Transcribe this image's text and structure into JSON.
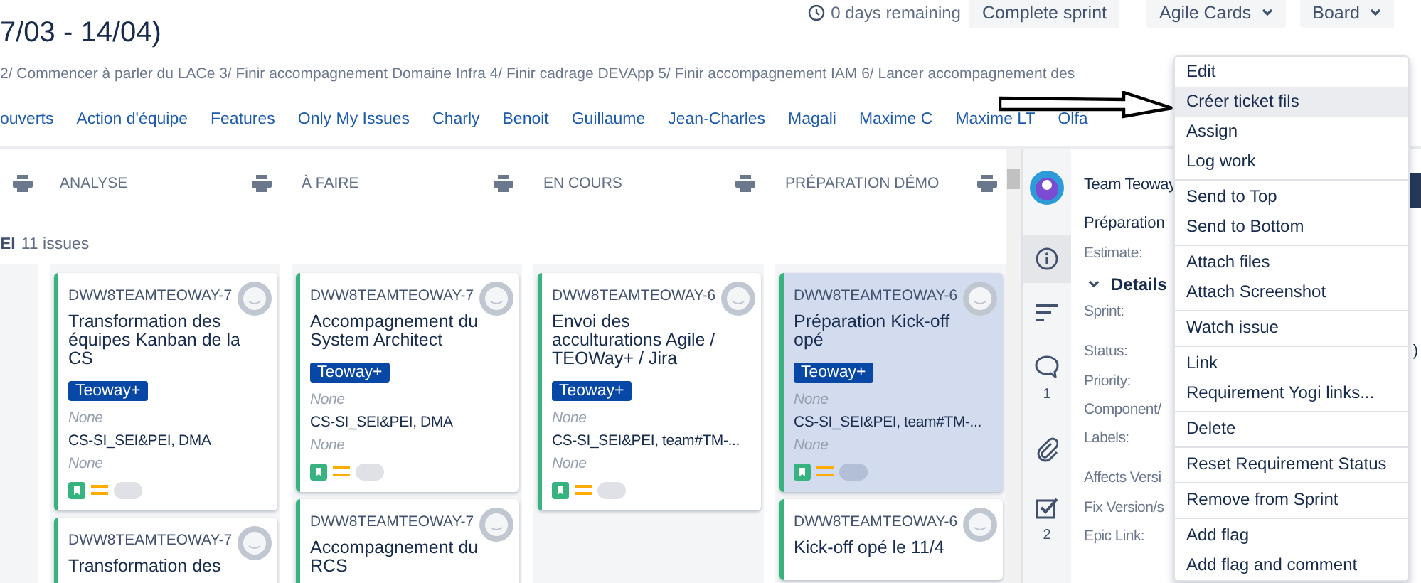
{
  "sprint": {
    "title": "7/03 - 14/04)",
    "goal": "2/ Commencer à parler du LACe 3/ Finir accompagnement Domaine Infra 4/ Finir cadrage DEVApp 5/ Finir accompagnement IAM 6/ Lancer accompagnement des",
    "days_remaining": "0 days remaining",
    "complete_button": "Complete sprint"
  },
  "header_buttons": [
    "Agile Cards",
    "Board"
  ],
  "quick_filters": [
    "ouverts",
    "Action d'équipe",
    "Features",
    "Only My Issues",
    "Charly",
    "Benoit",
    "Guillaume",
    "Jean-Charles",
    "Magali",
    "Maxime C",
    "Maxime LT",
    "Olfa"
  ],
  "swimlane": {
    "name": "EI",
    "count": "11 issues"
  },
  "columns": [
    {
      "title": "ANALYSE",
      "cards": [
        {
          "key": "DWW8TEAMTEOWAY-7",
          "summary": "Transformation des équipes Kanban de la CS",
          "label": "Teoway+",
          "selected": false,
          "fields": [
            {
              "value": "None",
              "empty": true
            },
            {
              "value": "CS-SI_SEI&PEI, DMA",
              "empty": false
            },
            {
              "value": "None",
              "empty": true
            }
          ]
        },
        {
          "key": "DWW8TEAMTEOWAY-7",
          "summary": "Transformation des",
          "selected": false
        }
      ]
    },
    {
      "title": "À FAIRE",
      "cards": [
        {
          "key": "DWW8TEAMTEOWAY-7",
          "summary": "Accompagnement du System Architect",
          "label": "Teoway+",
          "selected": false,
          "fields": [
            {
              "value": "None",
              "empty": true
            },
            {
              "value": "CS-SI_SEI&PEI, DMA",
              "empty": false
            },
            {
              "value": "None",
              "empty": true
            }
          ]
        },
        {
          "key": "DWW8TEAMTEOWAY-7",
          "summary": "Accompagnement du RCS",
          "selected": false
        }
      ]
    },
    {
      "title": "EN COURS",
      "cards": [
        {
          "key": "DWW8TEAMTEOWAY-6",
          "summary": "Envoi des acculturations Agile / TEOWay+ / Jira",
          "label": "Teoway+",
          "selected": false,
          "fields": [
            {
              "value": "None",
              "empty": true
            },
            {
              "value": "CS-SI_SEI&PEI, team#TM-...",
              "empty": false
            },
            {
              "value": "None",
              "empty": true
            }
          ]
        }
      ]
    },
    {
      "title": "PRÉPARATION DÉMO",
      "cards": [
        {
          "key": "DWW8TEAMTEOWAY-6",
          "summary": "Préparation Kick-off opé",
          "label": "Teoway+",
          "selected": true,
          "fields": [
            {
              "value": "None",
              "empty": true
            },
            {
              "value": "CS-SI_SEI&PEI, team#TM-...",
              "empty": false
            },
            {
              "value": "None",
              "empty": true
            }
          ]
        },
        {
          "key": "DWW8TEAMTEOWAY-6",
          "summary": "Kick-off opé le 11/4",
          "selected": false
        }
      ]
    }
  ],
  "detail": {
    "team": "Team Teoway",
    "summary": "Préparation",
    "estimate": "Estimate:",
    "section": "Details",
    "comment_count": "1",
    "checklist_count": "2",
    "field_groups": [
      [
        {
          "label": "Sprint:"
        }
      ],
      [
        {
          "label": "Status:",
          "value": ")"
        },
        {
          "label": "Priority:"
        },
        {
          "label": "Component/"
        },
        {
          "label": "Labels:"
        }
      ],
      [
        {
          "label": "Affects Versi"
        },
        {
          "label": "Fix Version/s"
        },
        {
          "label": "Epic Link:"
        }
      ]
    ]
  },
  "menu": [
    {
      "items": [
        {
          "label": "Edit",
          "selected": false
        },
        {
          "label": "Créer ticket fils",
          "selected": true
        },
        {
          "label": "Assign",
          "selected": false
        },
        {
          "label": "Log work",
          "selected": false
        }
      ]
    },
    {
      "items": [
        {
          "label": "Send to Top",
          "selected": false
        },
        {
          "label": "Send to Bottom",
          "selected": false
        }
      ]
    },
    {
      "items": [
        {
          "label": "Attach files",
          "selected": false
        },
        {
          "label": "Attach Screenshot",
          "selected": false
        }
      ]
    },
    {
      "items": [
        {
          "label": "Watch issue",
          "selected": false
        }
      ]
    },
    {
      "items": [
        {
          "label": "Link",
          "selected": false
        },
        {
          "label": "Requirement Yogi links...",
          "selected": false
        }
      ]
    },
    {
      "items": [
        {
          "label": "Delete",
          "selected": false
        }
      ]
    },
    {
      "items": [
        {
          "label": "Reset Requirement Status",
          "selected": false
        }
      ]
    },
    {
      "items": [
        {
          "label": "Remove from Sprint",
          "selected": false
        }
      ]
    },
    {
      "items": [
        {
          "label": "Add flag",
          "selected": false
        },
        {
          "label": "Add flag and comment",
          "selected": false
        }
      ]
    }
  ]
}
